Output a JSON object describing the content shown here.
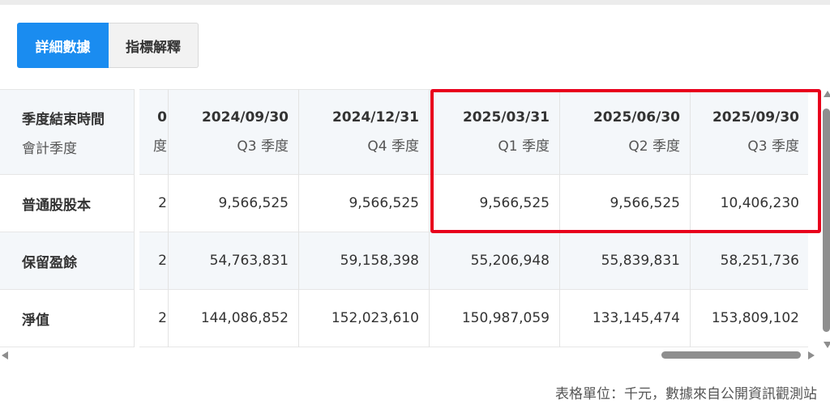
{
  "tabs": [
    {
      "label": "詳細數據",
      "active": true
    },
    {
      "label": "指標解釋",
      "active": false
    }
  ],
  "table": {
    "header": {
      "label": "季度結束時間",
      "sublabel": "會計季度"
    },
    "row_labels": [
      "普通股股本",
      "保留盈餘",
      "淨值"
    ],
    "partial_column": {
      "date": "0",
      "quarter": "度",
      "values": [
        "2",
        "2",
        "2"
      ]
    },
    "columns": [
      {
        "date": "2024/09/30",
        "quarter": "Q3 季度",
        "values": [
          "9,566,525",
          "54,763,831",
          "144,086,852"
        ]
      },
      {
        "date": "2024/12/31",
        "quarter": "Q4 季度",
        "values": [
          "9,566,525",
          "59,158,398",
          "152,023,610"
        ]
      },
      {
        "date": "2025/03/31",
        "quarter": "Q1 季度",
        "values": [
          "9,566,525",
          "55,206,948",
          "150,987,059"
        ]
      },
      {
        "date": "2025/06/30",
        "quarter": "Q2 季度",
        "values": [
          "9,566,525",
          "55,839,831",
          "133,145,474"
        ]
      },
      {
        "date": "2025/09/30",
        "quarter": "Q3 季度",
        "values": [
          "10,406,230",
          "58,251,736",
          "153,809,102"
        ]
      }
    ]
  },
  "footer": {
    "note": "表格單位：千元，數據來自公開資訊觀測站"
  },
  "colors": {
    "accent": "#1a8cf0",
    "highlight": "#e8001c",
    "header_bg": "#f4f7fa"
  }
}
